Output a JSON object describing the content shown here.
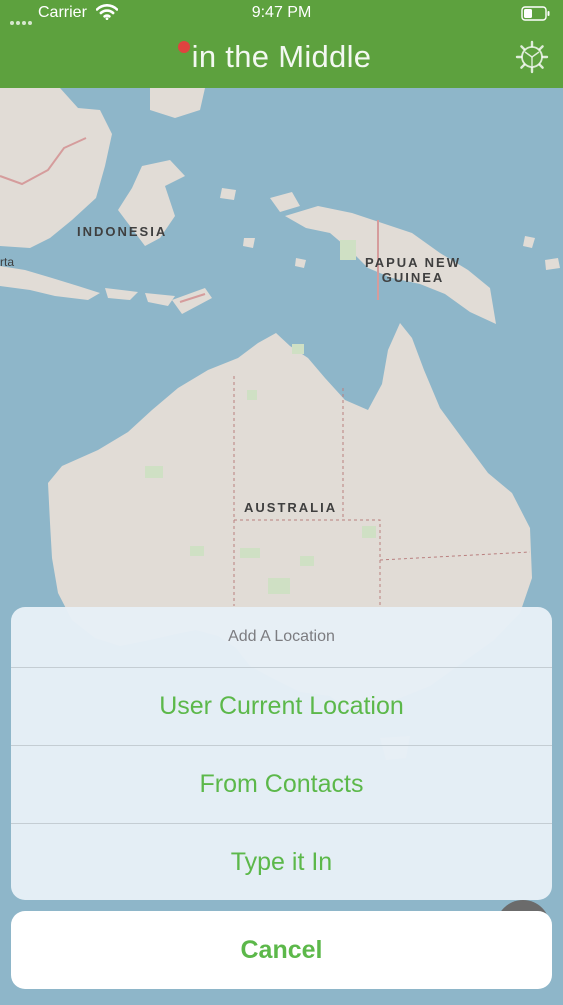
{
  "status_bar": {
    "carrier": "Carrier",
    "time": "9:47 PM"
  },
  "nav_bar": {
    "title": "in the Middle",
    "settings_icon": "gear-icon",
    "pin_color": "#e0433f"
  },
  "map": {
    "labels": {
      "indonesia": "INDONESIA",
      "papua_line1": "PAPUA NEW",
      "papua_line2": "GUINEA",
      "australia": "AUSTRALIA",
      "jakarta_fragment": "rta"
    }
  },
  "action_sheet": {
    "title": "Add A Location",
    "options": [
      {
        "label": "User Current Location"
      },
      {
        "label": "From Contacts"
      },
      {
        "label": "Type it In"
      }
    ],
    "cancel_label": "Cancel"
  },
  "colors": {
    "accent_green": "#5cb84a",
    "nav_green": "#5da13e",
    "ocean": "#8eb6c9",
    "land": "#e1dcd6"
  }
}
